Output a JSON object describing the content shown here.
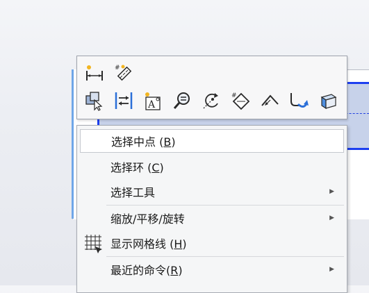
{
  "toolbar": {
    "row1": [
      {
        "id": "smart-dimension",
        "icon": "smart-dimension-icon"
      },
      {
        "id": "sketch-numbers",
        "icon": "sketch-numbers-icon"
      }
    ],
    "row2": [
      {
        "id": "select-other",
        "icon": "select-other-icon"
      },
      {
        "id": "relations",
        "icon": "relations-icon"
      },
      {
        "id": "annotation",
        "icon": "annotation-icon"
      },
      {
        "id": "zoom",
        "icon": "zoom-magnifier-icon"
      },
      {
        "id": "rotate",
        "icon": "rotate-view-icon"
      },
      {
        "id": "sketch-plane",
        "icon": "sketch-plane-icon"
      },
      {
        "id": "normal-to",
        "icon": "normal-to-icon"
      },
      {
        "id": "undo-feature",
        "icon": "undo-feature-icon"
      },
      {
        "id": "extrude",
        "icon": "extrude-icon"
      }
    ]
  },
  "menu": {
    "items": [
      {
        "text": "选择中点 (",
        "key": "B",
        "tail": ")",
        "submenu": false,
        "hover": true
      },
      {
        "text": "选择环 (",
        "key": "C",
        "tail": ")",
        "submenu": false
      },
      {
        "text": "选择工具",
        "key": "",
        "tail": "",
        "submenu": true
      },
      {
        "text": "缩放/平移/旋转",
        "key": "",
        "tail": "",
        "submenu": true
      },
      {
        "text": "显示网格线 (",
        "key": "H",
        "tail": ")",
        "submenu": false,
        "icon": "grid-lines-icon"
      },
      {
        "text": "最近的命令(",
        "key": "R",
        "tail": ")",
        "submenu": true
      }
    ]
  },
  "colors": {
    "model_fill": "#c7d2ea",
    "model_edge": "#1d3ff0",
    "accent": "#2b6fd8"
  }
}
